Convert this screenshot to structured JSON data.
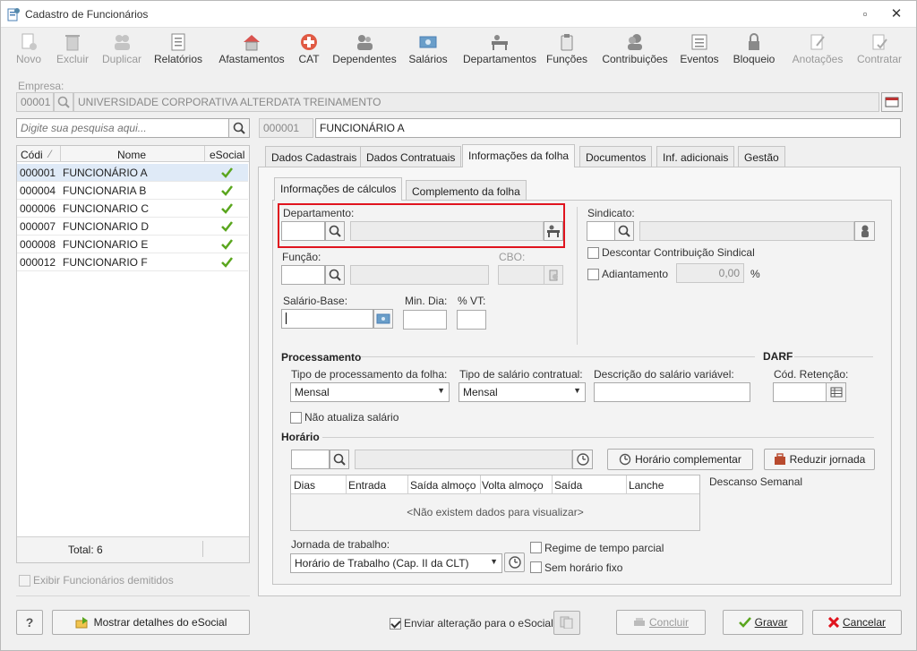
{
  "window": {
    "title": "Cadastro de Funcionários"
  },
  "toolbar": [
    {
      "label": "Novo",
      "enabled": false
    },
    {
      "label": "Excluir",
      "enabled": false
    },
    {
      "label": "Duplicar",
      "enabled": false
    },
    {
      "label": "Relatórios",
      "enabled": true
    },
    {
      "label": "Afastamentos",
      "enabled": true
    },
    {
      "label": "CAT",
      "enabled": true
    },
    {
      "label": "Dependentes",
      "enabled": true
    },
    {
      "label": "Salários",
      "enabled": true
    },
    {
      "label": "Departamentos",
      "enabled": true
    },
    {
      "label": "Funções",
      "enabled": true
    },
    {
      "label": "Contribuições",
      "enabled": true
    },
    {
      "label": "Eventos",
      "enabled": true
    },
    {
      "label": "Bloqueio",
      "enabled": true
    },
    {
      "label": "Anotações",
      "enabled": false
    },
    {
      "label": "Contratar",
      "enabled": false
    }
  ],
  "empresa": {
    "label": "Empresa:",
    "code": "00001",
    "name": "UNIVERSIDADE CORPORATIVA ALTERDATA TREINAMENTO"
  },
  "search": {
    "placeholder": "Digite sua pesquisa aqui..."
  },
  "current": {
    "code": "000001",
    "name": "FUNCIONÁRIO A"
  },
  "list": {
    "headers": [
      "Códi",
      "Nome",
      "eSocial"
    ],
    "rows": [
      {
        "code": "000001",
        "name": "FUNCIONÁRIO A"
      },
      {
        "code": "000004",
        "name": "FUNCIONARIA B"
      },
      {
        "code": "000006",
        "name": "FUNCIONARIO C"
      },
      {
        "code": "000007",
        "name": "FUNCIONARIO D"
      },
      {
        "code": "000008",
        "name": "FUNCIONARIO E"
      },
      {
        "code": "000012",
        "name": "FUNCIONARIO F"
      }
    ],
    "total": "Total: 6",
    "show_dismissed": "Exibir Funcionários demitidos"
  },
  "tabs": [
    "Dados Cadastrais",
    "Dados Contratuais",
    "Informações da folha",
    "Documentos",
    "Inf. adicionais",
    "Gestão"
  ],
  "subtabs": [
    "Informações de cálculos",
    "Complemento da folha"
  ],
  "form": {
    "departamento": "Departamento:",
    "sindicato": "Sindicato:",
    "descontar": "Descontar Contribuição Sindical",
    "adiantamento": "Adiantamento",
    "adiantamento_value": "0,00",
    "percent": "%",
    "funcao": "Função:",
    "cbo": "CBO:",
    "salario_base": "Salário-Base:",
    "min_dia": "Min. Dia:",
    "vt": "% VT:"
  },
  "processamento": {
    "title": "Processamento",
    "darf": "DARF",
    "tipo_proc_label": "Tipo de processamento da folha:",
    "tipo_proc_value": "Mensal",
    "tipo_sal_label": "Tipo de salário contratual:",
    "tipo_sal_value": "Mensal",
    "desc_sal_label": "Descrição do salário variável:",
    "cod_ret_label": "Cód. Retenção:",
    "nao_atualiza": "Não atualiza salário"
  },
  "horario": {
    "title": "Horário",
    "btn_complementar": "Horário complementar",
    "btn_reduzir": "Reduzir jornada",
    "grid_headers": [
      "Dias",
      "Entrada",
      "Saída almoço",
      "Volta almoço",
      "Saída",
      "Lanche"
    ],
    "empty": "<Não existem dados para visualizar>",
    "descanso": "Descanso Semanal",
    "jornada_label": "Jornada de trabalho:",
    "jornada_value": "Horário de Trabalho (Cap. II da CLT)",
    "regime": "Regime de tempo parcial",
    "sem_horario": "Sem horário fixo"
  },
  "footer": {
    "help": "?",
    "esocial_details": "Mostrar detalhes do eSocial",
    "enviar": "Enviar alteração para o eSocial",
    "concluir": "Concluir",
    "gravar": "Gravar",
    "cancelar": "Cancelar"
  },
  "colors": {
    "highlight": "#e0141e",
    "check": "#5aa61e",
    "selected_row": "#dfeaf7"
  }
}
